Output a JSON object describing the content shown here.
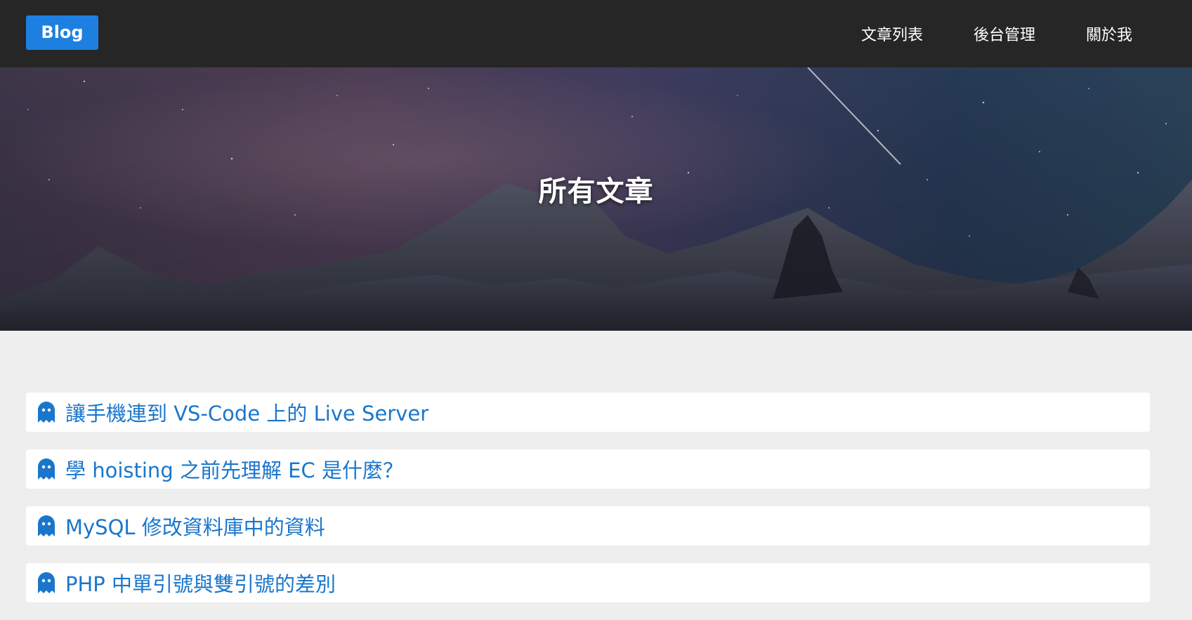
{
  "navbar": {
    "brand": "Blog",
    "links": [
      {
        "label": "文章列表"
      },
      {
        "label": "後台管理"
      },
      {
        "label": "關於我"
      }
    ]
  },
  "hero": {
    "title": "所有文章"
  },
  "posts": [
    {
      "title": "讓手機連到 VS-Code 上的 Live Server",
      "icon": "ghost-icon"
    },
    {
      "title": "學 hoisting 之前先理解 EC 是什麼？",
      "icon": "ghost-icon"
    },
    {
      "title": "MySQL 修改資料庫中的資料",
      "icon": "ghost-icon"
    },
    {
      "title": "PHP 中單引號與雙引號的差別",
      "icon": "ghost-icon"
    }
  ],
  "colors": {
    "accent": "#1d80e0",
    "link": "#1a76cc",
    "navbar": "#262626",
    "background": "#eeeeee"
  }
}
